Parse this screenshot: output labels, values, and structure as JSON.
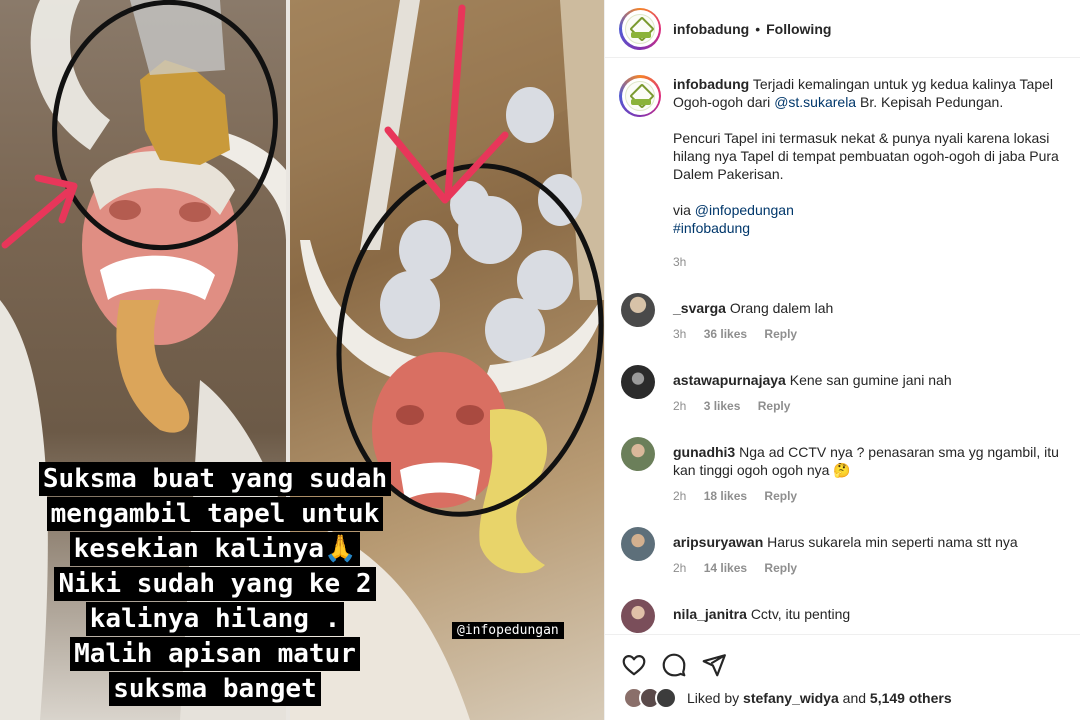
{
  "photo": {
    "caption_lines": [
      "Suksma buat yang sudah",
      "mengambil tapel untuk",
      "kesekian kalinya🙏",
      "Niki sudah yang ke 2",
      "kalinya hilang .",
      "Malih apisan matur",
      "suksma banget"
    ],
    "watermark": "@infopedungan"
  },
  "header": {
    "username": "infobadung",
    "separator": "•",
    "follow_status": "Following"
  },
  "post": {
    "username": "infobadung",
    "para1_text": "Terjadi kemalingan untuk yg kedua kalinya Tapel Ogoh-ogoh dari ",
    "para1_mention": "@st.sukarela",
    "para1_rest": " Br. Kepisah Pedungan.",
    "para2": "Pencuri Tapel ini termasuk nekat & punya nyali karena lokasi hilang nya Tapel di tempat pembuatan ogoh-ogoh di jaba Pura Dalem Pakerisan.",
    "via_prefix": "via ",
    "via_mention": "@infopedungan",
    "hashtag": "#infobadung",
    "time": "3h"
  },
  "comments": [
    {
      "username": "_svarga",
      "text": "Orang dalem lah",
      "time": "3h",
      "likes": "36 likes",
      "reply": "Reply",
      "avatar_color": "#4a4a4a"
    },
    {
      "username": "astawapurnajaya",
      "text": "Kene san gumine jani nah",
      "time": "2h",
      "likes": "3 likes",
      "reply": "Reply",
      "avatar_color": "#2b2b2b"
    },
    {
      "username": "gunadhi3",
      "text": "Nga ad CCTV nya ? penasaran sma yg ngambil, itu kan tinggi ogoh ogoh nya 🤔",
      "time": "2h",
      "likes": "18 likes",
      "reply": "Reply",
      "avatar_color": "#6b7f5a"
    },
    {
      "username": "aripsuryawan",
      "text": "Harus sukarela min seperti nama stt nya",
      "time": "2h",
      "likes": "14 likes",
      "reply": "Reply",
      "avatar_color": "#5d6f7a"
    },
    {
      "username": "nila_janitra",
      "text": "Cctv, itu penting",
      "time": "",
      "likes": "",
      "reply": "",
      "avatar_color": "#7a4e5a"
    }
  ],
  "footer": {
    "icons": [
      "heart-icon",
      "comment-icon",
      "share-icon"
    ],
    "liked_prefix": "Liked by ",
    "liked_user": "stefany_widya",
    "liked_mid": " and ",
    "liked_count": "5,149 others"
  }
}
